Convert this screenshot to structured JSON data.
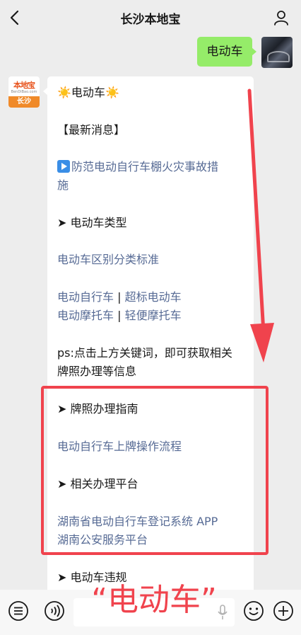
{
  "nav": {
    "title": "长沙本地宝",
    "back_icon": "chevron-left-icon",
    "profile_icon": "person-icon"
  },
  "sent_message": "电动车",
  "bot_avatar": {
    "brand": "本地宝",
    "url": "BenDiBao.com",
    "city": "长沙"
  },
  "reply": {
    "sun": "☀️",
    "heading": "电动车",
    "latest_news": "【最新消息】",
    "news_link_line1": "防范电动自行车棚火灾事故措",
    "news_link_line2": "施",
    "section_types": "➤ 电动车类型",
    "link_classify": "电动车区别分类标准",
    "link_ebike": "电动自行车",
    "link_over_std": "超标电动车",
    "link_moto": "电动摩托车",
    "link_light_moto": "轻便摩托车",
    "separator": "|",
    "ps_line1": "ps:点击上方关键词，即可获取相关",
    "ps_line2": "牌照办理等信息",
    "section_plate": "➤ 牌照办理指南",
    "link_plate_flow": "电动自行车上牌操作流程",
    "section_platform": "➤ 相关办理平台",
    "link_app": "湖南省电动自行车登记系统 APP",
    "link_police": "湖南公安服务平台",
    "section_violation": "➤ 电动车违规"
  },
  "input_overlay": {
    "open_quote": "“",
    "keyword": "电动车",
    "close_quote": "”"
  },
  "colors": {
    "link": "#576b95",
    "bubble_out": "#95ec69",
    "annotation": "#f0434d",
    "background": "#ededed"
  }
}
